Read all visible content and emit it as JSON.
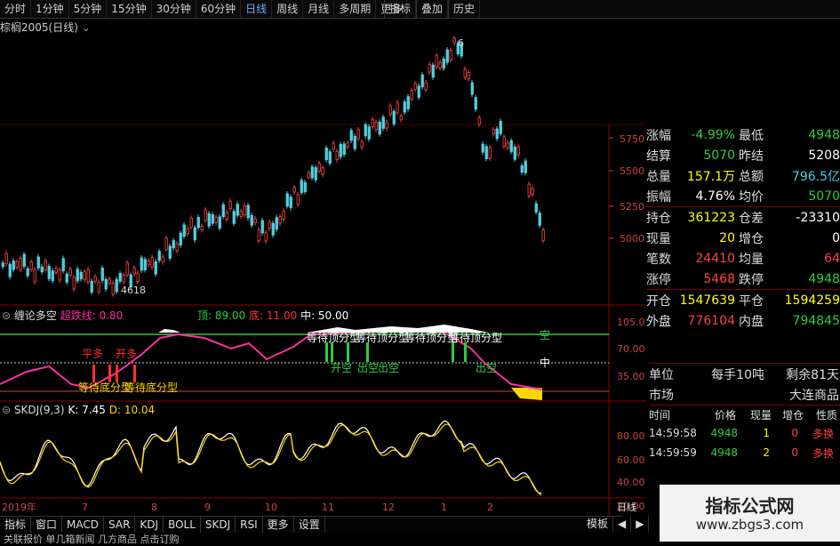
{
  "toolbar": {
    "periods": [
      "分时",
      "1分钟",
      "5分钟",
      "15分钟",
      "30分钟",
      "60分钟",
      "日线",
      "周线",
      "月线",
      "多周期",
      "更多"
    ],
    "active": "日线",
    "right_buttons": [
      "指标",
      "叠加",
      "历史"
    ]
  },
  "chart": {
    "symbol_title": "棕榈2005(日线)",
    "high_label": "6",
    "low_label": "4618",
    "price_ticks": [
      "5750",
      "5500",
      "5250",
      "5000"
    ],
    "month_labels": [
      "2019年",
      "7",
      "8",
      "9",
      "10",
      "11",
      "12",
      "1",
      "2"
    ],
    "period_label": "日线"
  },
  "indicator1": {
    "name": "缠论多空",
    "extra": "超跌线: 0.80",
    "top_label": "顶: 89.00",
    "bottom_label": "底: 11.00",
    "mid_label": "中: 50.00",
    "ticks": [
      "105.0",
      "70.00",
      "35.00"
    ],
    "signals": {
      "top_shape": "等待顶分型",
      "bottom_shape": "等待底分型",
      "long": "平多",
      "long2": "开多",
      "short": "开空",
      "sell": "出空",
      "top_word": "空",
      "mid_word": "中"
    }
  },
  "indicator2": {
    "name": "SKDJ(9,3)",
    "k": "K: 7.45",
    "d": "D: 10.04",
    "ticks": [
      "80.00",
      "60.00",
      "40.00",
      "20.00"
    ]
  },
  "quote": {
    "rows": [
      {
        "l1": "涨幅",
        "v1": "-4.99%",
        "c1": "#2ecc40",
        "l2": "最低",
        "v2": "4948",
        "c2": "#2ecc40"
      },
      {
        "l1": "结算",
        "v1": "5070",
        "c1": "#2ecc40",
        "l2": "昨结",
        "v2": "5208",
        "c2": "#ffffff"
      },
      {
        "l1": "总量",
        "v1": "157.1万",
        "c1": "#ffff00",
        "l2": "总额",
        "v2": "796.5亿",
        "c2": "#4fd0e0"
      },
      {
        "l1": "振幅",
        "v1": "4.76%",
        "c1": "#ffffff",
        "l2": "均价",
        "v2": "5070",
        "c2": "#2ecc40"
      },
      {
        "l1": "持仓",
        "v1": "361223",
        "c1": "#ffff00",
        "l2": "仓差",
        "v2": "-23310",
        "c2": "#ffffff"
      },
      {
        "l1": "现量",
        "v1": "20",
        "c1": "#ffff00",
        "l2": "增仓",
        "v2": "0",
        "c2": "#ffffff"
      },
      {
        "l1": "笔数",
        "v1": "24410",
        "c1": "#ff4040",
        "l2": "均量",
        "v2": "64",
        "c2": "#ff4040"
      },
      {
        "l1": "涨停",
        "v1": "5468",
        "c1": "#ff4040",
        "l2": "跌停",
        "v2": "4948",
        "c2": "#2ecc40"
      },
      {
        "l1": "开仓",
        "v1": "1547639",
        "c1": "#ffff00",
        "l2": "平仓",
        "v2": "1594259",
        "c2": "#ffff00"
      },
      {
        "l1": "外盘",
        "v1": "776104",
        "c1": "#ff4040",
        "l2": "内盘",
        "v2": "794845",
        "c2": "#2ecc40"
      }
    ],
    "unit_label": "单位",
    "unit_value": "每手10吨",
    "remaining": "剩余81天",
    "market_label": "市场",
    "market_value": "大连商品",
    "trade_headers": [
      "时间",
      "价格",
      "现量",
      "增仓",
      "性质"
    ],
    "trades": [
      {
        "time": "14:59:58",
        "price": "4948",
        "vol": "1",
        "oi": "0",
        "nature": "多换"
      },
      {
        "time": "14:59:59",
        "price": "4948",
        "vol": "2",
        "oi": "0",
        "nature": "多换"
      }
    ]
  },
  "bottom_tabs": [
    "指标",
    "窗口",
    "MACD",
    "SAR",
    "KDJ",
    "BOLL",
    "SKDJ",
    "RSI",
    "更多",
    "设置"
  ],
  "bottom_right": [
    "模板",
    "◀",
    "▶"
  ],
  "status_partial": "关联报价    单几箱新闻     几方商品    点击订购",
  "watermark": {
    "title": "指标公式网",
    "url": "www.zbgs3.com"
  }
}
